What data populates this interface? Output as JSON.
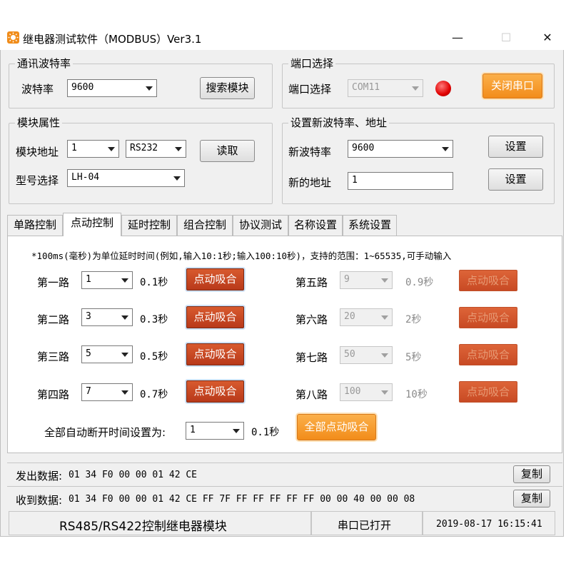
{
  "window": {
    "title": "继电器测试软件（MODBUS）Ver3.1",
    "minimize_glyph": "—",
    "maximize_glyph": "☐",
    "close_glyph": "✕"
  },
  "baud_group": {
    "title": "通讯波特率",
    "baud_label": "波特率",
    "baud_value": "9600",
    "search_button": "搜索模块"
  },
  "port_group": {
    "title": "端口选择",
    "port_label": "端口选择",
    "port_value": "COM11",
    "close_port_button": "关闭串口",
    "led_color": "#e00000"
  },
  "module_group": {
    "title": "模块属性",
    "address_label": "模块地址",
    "address_value": "1",
    "interface_value": "RS232",
    "read_button": "读取",
    "model_label": "型号选择",
    "model_value": "LH-04"
  },
  "set_group": {
    "title": "设置新波特率、地址",
    "new_baud_label": "新波特率",
    "new_baud_value": "9600",
    "set_button_1": "设置",
    "new_address_label": "新的地址",
    "new_address_value": "1",
    "set_button_2": "设置"
  },
  "tabs": [
    "单路控制",
    "点动控制",
    "延时控制",
    "组合控制",
    "协议测试",
    "名称设置",
    "系统设置"
  ],
  "active_tab": "点动控制",
  "jog": {
    "note": "*100ms(毫秒)为单位延时时间(例如,输入10:1秒;输入100:10秒)，支持的范围：1~65535,可手动输入",
    "button_label": "点动吸合",
    "channels": [
      {
        "name": "第一路",
        "value": "1",
        "time": "0.1秒",
        "enabled": true
      },
      {
        "name": "第二路",
        "value": "3",
        "time": "0.3秒",
        "enabled": true
      },
      {
        "name": "第三路",
        "value": "5",
        "time": "0.5秒",
        "enabled": true
      },
      {
        "name": "第四路",
        "value": "7",
        "time": "0.7秒",
        "enabled": true
      },
      {
        "name": "第五路",
        "value": "9",
        "time": "0.9秒",
        "enabled": false
      },
      {
        "name": "第六路",
        "value": "20",
        "time": "2秒",
        "enabled": false
      },
      {
        "name": "第七路",
        "value": "50",
        "time": "5秒",
        "enabled": false
      },
      {
        "name": "第八路",
        "value": "100",
        "time": "10秒",
        "enabled": false
      }
    ],
    "all_label": "全部自动断开时间设置为:",
    "all_value": "1",
    "all_time": "0.1秒",
    "all_button": "全部点动吸合"
  },
  "sent": {
    "label": "发出数据:",
    "value": "01 34 F0 00 00 01 42 CE",
    "copy_button": "复制"
  },
  "received": {
    "label": "收到数据:",
    "value": "01 34 F0 00 00 01 42 CE FF 7F FF FF FF FF FF 00 00 40 00 00 08",
    "copy_button": "复制"
  },
  "statusbar": {
    "module_text": "RS485/RS422控制继电器模块",
    "port_status": "串口已打开",
    "datetime": "2019-08-17 16:15:41"
  }
}
